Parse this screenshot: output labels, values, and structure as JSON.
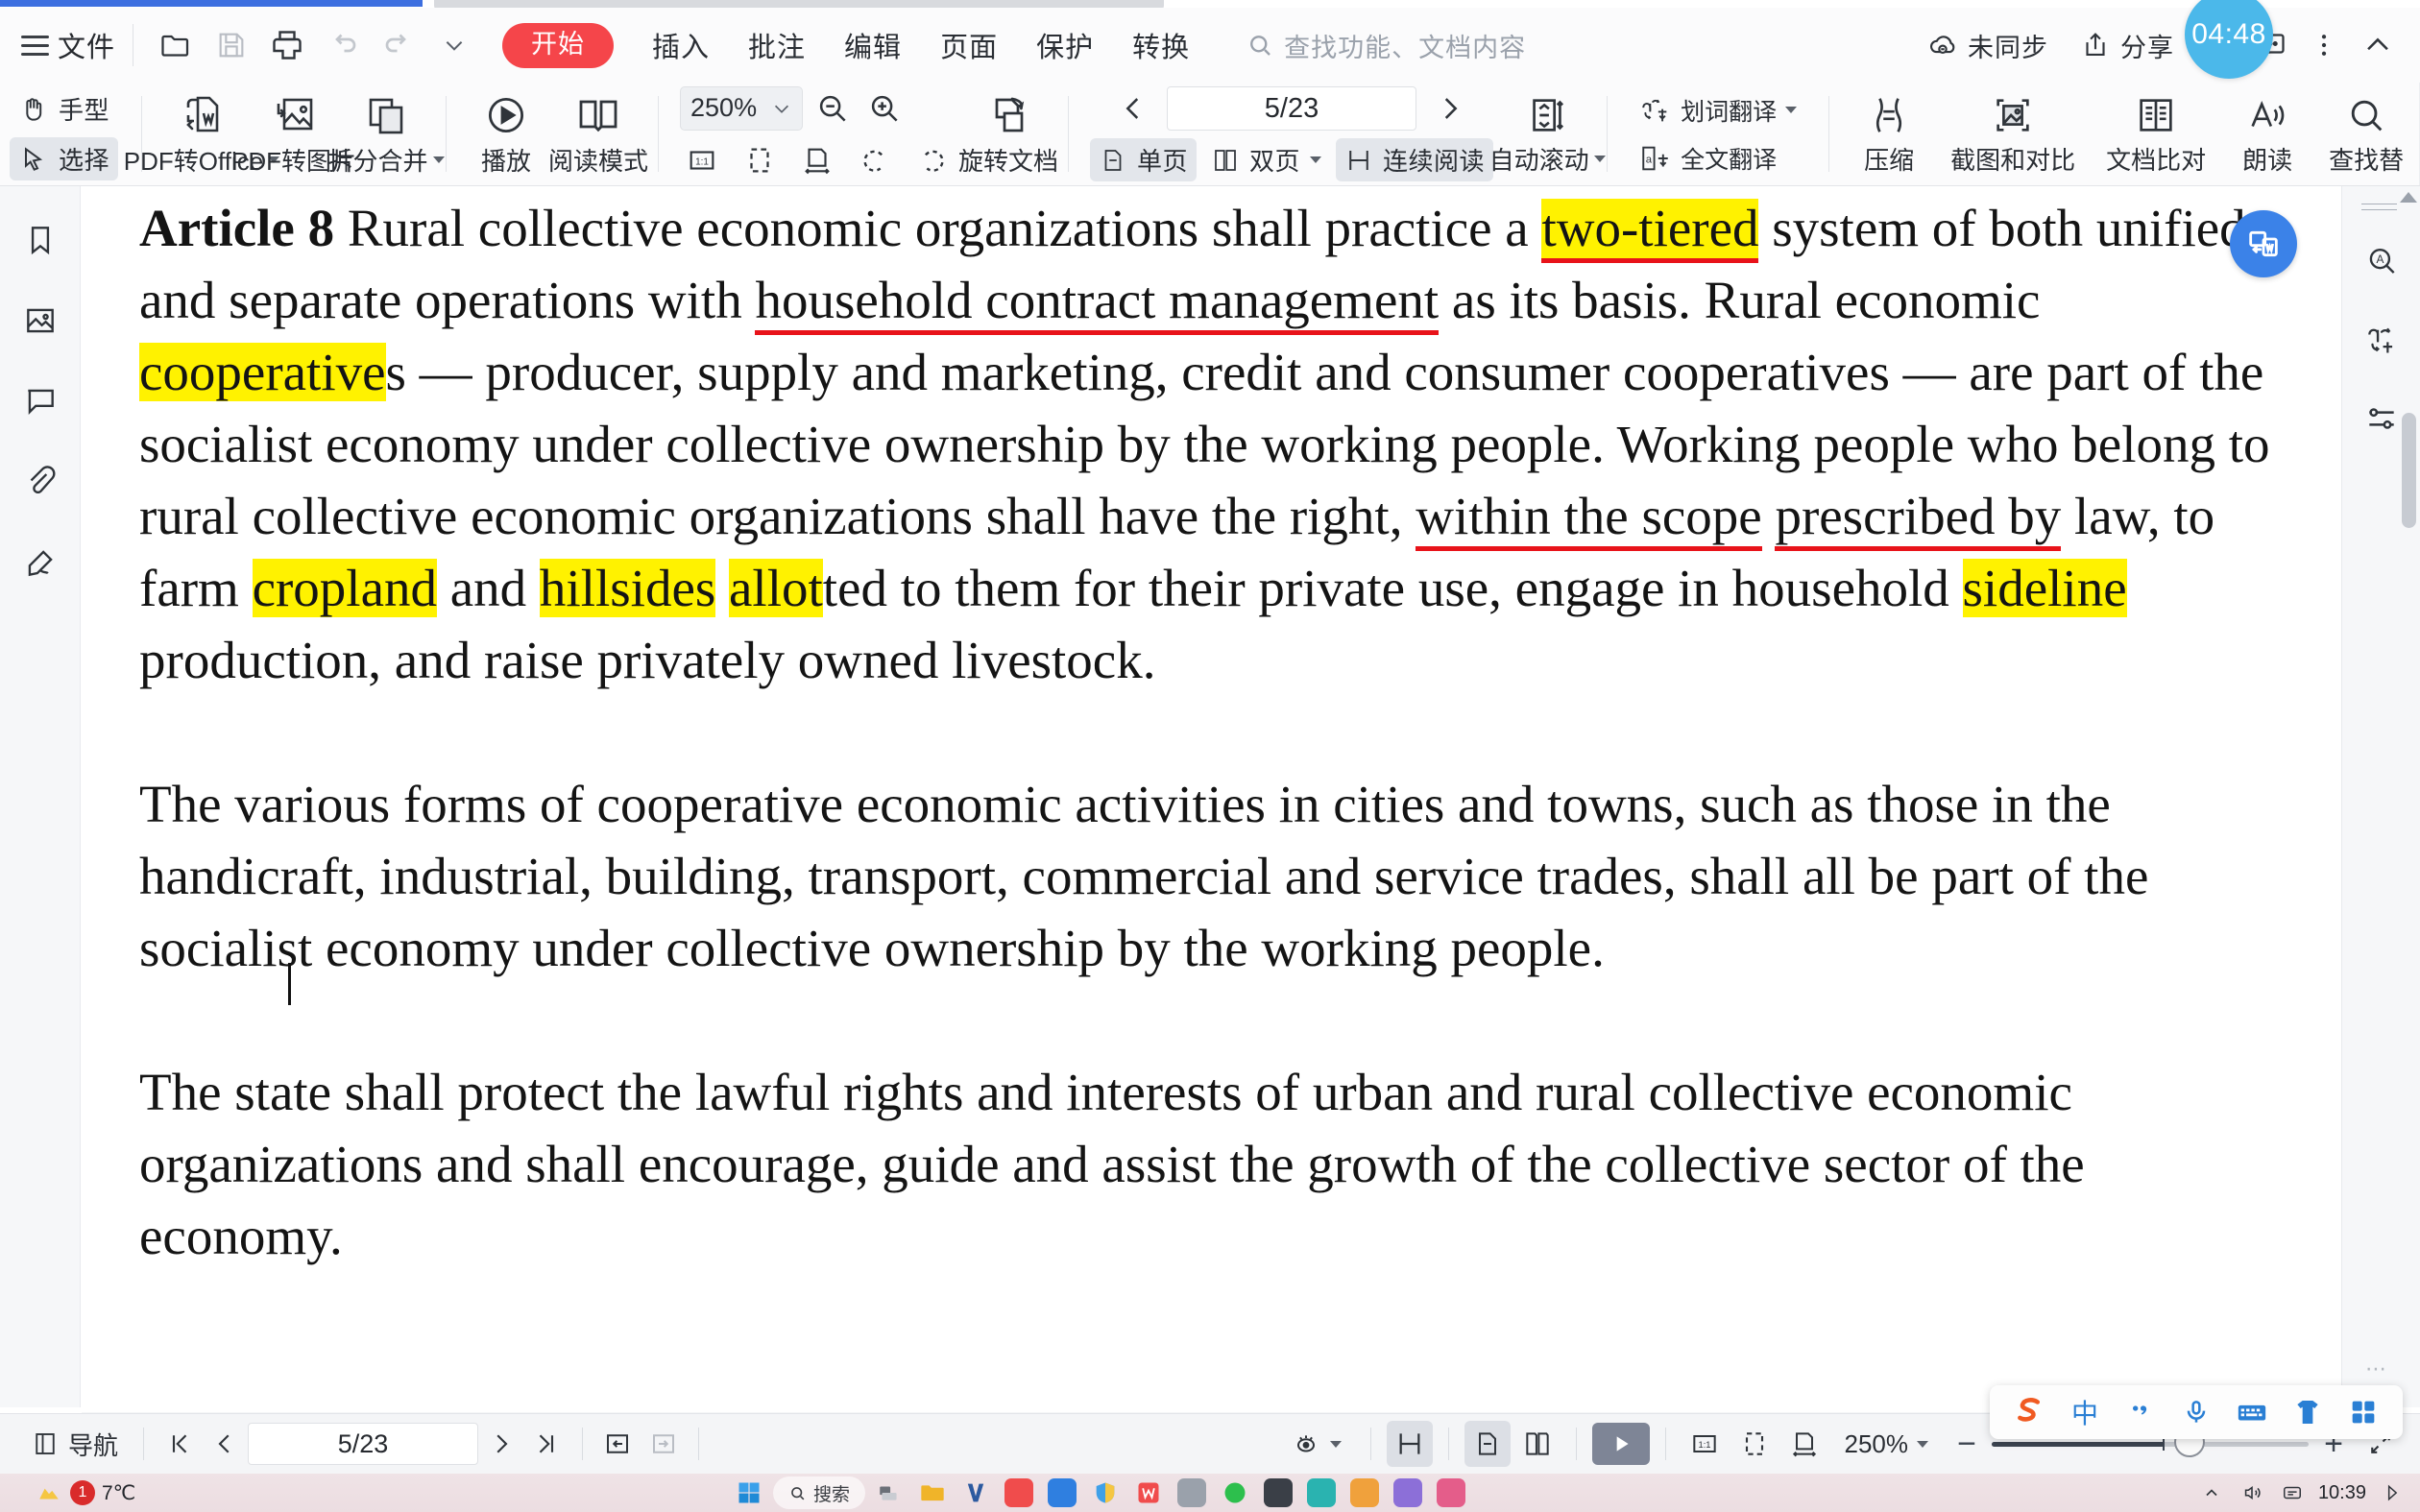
{
  "window": {
    "tab_title": ""
  },
  "menubar": {
    "file_label": "文件",
    "quick_actions": [
      {
        "name": "open-folder-icon",
        "title": "打开"
      },
      {
        "name": "save-icon",
        "title": "保存"
      },
      {
        "name": "print-icon",
        "title": "打印"
      },
      {
        "name": "undo-icon",
        "title": "撤销"
      },
      {
        "name": "redo-icon",
        "title": "恢复"
      },
      {
        "name": "chevron-down-icon",
        "title": "更多"
      }
    ],
    "start_tab": "开始",
    "tabs": [
      "插入",
      "批注",
      "编辑",
      "页面",
      "保护",
      "转换"
    ],
    "search_placeholder": "查找功能、文档内容",
    "sync_label": "未同步",
    "share_label": "分享",
    "timer": "04:48"
  },
  "ribbon": {
    "hand_tool": "手型",
    "select_tool": "选择",
    "pdf_to_office": "PDF转Office",
    "pdf_to_image": "PDF转图片",
    "split_merge": "拆分合并",
    "play": "播放",
    "reading_mode": "阅读模式",
    "zoom_value": "250%",
    "rotate_doc": "旋转文档",
    "page_indicator": "5/23",
    "single_page": "单页",
    "double_page": "双页",
    "continuous_read": "连续阅读",
    "auto_scroll": "自动滚动",
    "word_translate": "划词翻译",
    "full_translate": "全文翻译",
    "compress": "压缩",
    "screenshot_compare": "截图和对比",
    "doc_compare": "文档比对",
    "read_aloud": "朗读",
    "find_replace": "查找替"
  },
  "left_rail": [
    {
      "name": "bookmark-icon",
      "label": "书签"
    },
    {
      "name": "thumbnail-image-icon",
      "label": "缩略图"
    },
    {
      "name": "comment-icon",
      "label": "批注"
    },
    {
      "name": "attachment-icon",
      "label": "附件"
    },
    {
      "name": "signature-pen-icon",
      "label": "签名"
    }
  ],
  "right_rail": [
    {
      "name": "search-text-icon",
      "label": "查找"
    },
    {
      "name": "translate-icon",
      "label": "翻译"
    },
    {
      "name": "settings-sliders-icon",
      "label": "设置"
    }
  ],
  "document": {
    "paragraphs": [
      {
        "id": "p1",
        "runs": [
          {
            "text": "Article 8",
            "style": "bold"
          },
          {
            "text": " Rural collective economic organizations shall  practice a ",
            "style": "normal"
          },
          {
            "text": "two-tiered",
            "style": "highlight-underline"
          },
          {
            "text": " system of both unified and separate operations with ",
            "style": "normal"
          },
          {
            "text": "household contract management",
            "style": "underline"
          },
          {
            "text": " as its basis. Rural economic ",
            "style": "normal"
          },
          {
            "text": "cooperative",
            "style": "highlight"
          },
          {
            "text": "s —  producer, supply and marketing, credit and consumer cooperatives —  are part of the socialist economy under collective ownership  by the working people. Working people who belong to rural collective economic organizations shall have the right, ",
            "style": "normal"
          },
          {
            "text": "within the scope",
            "style": "underline"
          },
          {
            "text": "  ",
            "style": "normal"
          },
          {
            "text": "prescribed by",
            "style": "underline"
          },
          {
            "text": " law, to farm ",
            "style": "normal"
          },
          {
            "text": "cropland",
            "style": "highlight"
          },
          {
            "text": " and ",
            "style": "normal"
          },
          {
            "text": "hillsides",
            "style": "highlight"
          },
          {
            "text": " ",
            "style": "normal"
          },
          {
            "text": "allot",
            "style": "highlight"
          },
          {
            "text": "ted to them for their private use, engage in household ",
            "style": "normal"
          },
          {
            "text": "sideline",
            "style": "highlight"
          },
          {
            "text": " production, and raise privately owned livestock.",
            "style": "normal"
          }
        ]
      },
      {
        "id": "p2",
        "runs": [
          {
            "text": "The various forms of cooperative economic activities in cities and towns, such as those in the handicraft, industrial, building, transport, commercial and service trades,  shall  all be part of  the socialist economy under collective ownership by the working people.",
            "style": "normal"
          }
        ]
      },
      {
        "id": "p3",
        "runs": [
          {
            "text": "The state shall protect the lawful rights and interests of urban and rural collective economic organizations and shall encourage, guide and assist the growth of the collective sector of the economy.",
            "style": "normal"
          }
        ]
      }
    ]
  },
  "statusbar": {
    "nav_label": "导航",
    "page_indicator": "5/23",
    "zoom_value": "250%"
  },
  "ime": {
    "mode_label": "中"
  },
  "taskbar": {
    "temperature": "7℃",
    "badge_count": "1",
    "search_placeholder": "搜索",
    "clock": "10:39"
  },
  "colors": {
    "accent_red": "#f5454a",
    "highlight_yellow": "#fff200",
    "underline_red": "#e8131a",
    "badge_blue": "#3b82e8",
    "timer_blue": "#4bb8ea",
    "tab_blue": "#3d6fe0"
  }
}
